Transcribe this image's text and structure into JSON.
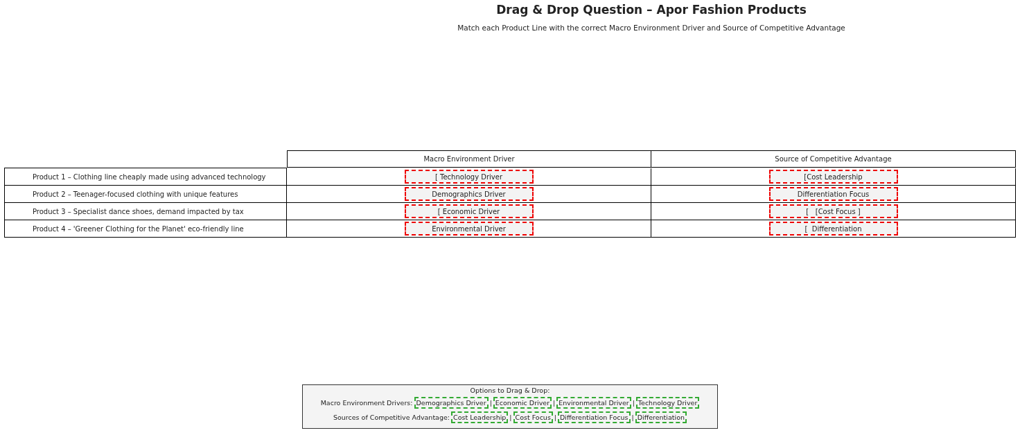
{
  "title": "Drag & Drop Question – Apor Fashion Products",
  "subtitle": "Match each Product Line with the correct Macro Environment Driver and Source of Competitive Advantage",
  "table": {
    "columns": [
      "Macro Environment Driver",
      "Source of Competitive Advantage"
    ],
    "rows": [
      {
        "product": "Product 1 – Clothing line cheaply made using advanced technology",
        "driver": "[ Technology Driver",
        "advantage": "[Cost Leadership"
      },
      {
        "product": "Product 2 – Teenager-focused clothing with unique features",
        "driver": "Demographics Driver",
        "advantage": "Differentiation Focus"
      },
      {
        "product": "Product 3 – Specialist dance shoes, demand impacted by tax",
        "driver": "[ Economic Driver",
        "advantage": "[   [Cost Focus ]"
      },
      {
        "product": "Product 4 – 'Greener Clothing for the Planet' eco-friendly line",
        "driver": "Environmental Driver",
        "advantage": "[  Differentiation"
      }
    ]
  },
  "options": {
    "title": "Options to Drag & Drop:",
    "separator": "|",
    "groups": [
      {
        "label": "Macro Environment Drivers:",
        "items": [
          "Demographics Driver",
          "Economic Driver",
          "Environmental Driver",
          "Technology Driver"
        ]
      },
      {
        "label": "Sources of Competitive Advantage:",
        "items": [
          "Cost Leadership",
          "Cost Focus",
          "Differentiation Focus",
          "Differentiation"
        ]
      }
    ]
  }
}
